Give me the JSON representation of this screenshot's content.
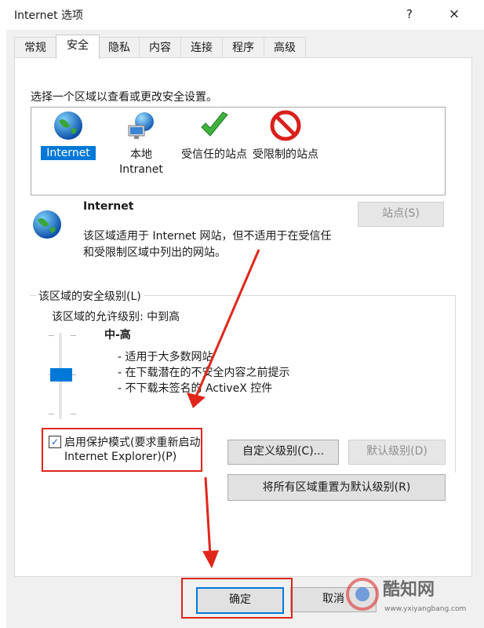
{
  "window": {
    "title": "Internet 选项",
    "help": "?",
    "close": "×"
  },
  "tabs": [
    "常规",
    "安全",
    "隐私",
    "内容",
    "连接",
    "程序",
    "高级"
  ],
  "active_tab": "安全",
  "security": {
    "instruction": "选择一个区域以查看或更改安全设置。",
    "zones": [
      {
        "label": "Internet",
        "icon": "globe-icon",
        "selected": true
      },
      {
        "label": "本地\nIntranet",
        "icon": "local-network-icon",
        "selected": false
      },
      {
        "label": "受信任的站点",
        "icon": "check-mark-icon",
        "selected": false
      },
      {
        "label": "受限制的站点",
        "icon": "no-entry-icon",
        "selected": false
      }
    ],
    "zone_title": "Internet",
    "zone_desc_line1": "该区域适用于 Internet 网站，但不适用于在受信任",
    "zone_desc_line2": "和受限制区域中列出的网站。",
    "sites_button": "站点(S)",
    "level_group_label": "该区域的安全级别(L)",
    "allowed_levels": "该区域的允许级别: 中到高",
    "level_name": "中-高",
    "level_desc": [
      "- 适用于大多数网站",
      "- 在下载潜在的不安全内容之前提示",
      "- 不下载未签名的 ActiveX 控件"
    ],
    "slider_level": "中-高",
    "protected_mode_line1": "启用保护模式(要求重新启动",
    "protected_mode_line2": "Internet Explorer)(P)",
    "protected_mode_checked": true,
    "custom_level_button": "自定义级别(C)...",
    "default_level_button": "默认级别(D)",
    "reset_all_button": "将所有区域重置为默认级别(R)"
  },
  "footer": {
    "ok_button": "确定",
    "cancel_button": "取消"
  },
  "watermark": {
    "text1": "酷知网",
    "text2": "www.yxiyangbang.com"
  },
  "colors": {
    "accent": "#0078d7",
    "annotation": "#e0261b"
  }
}
